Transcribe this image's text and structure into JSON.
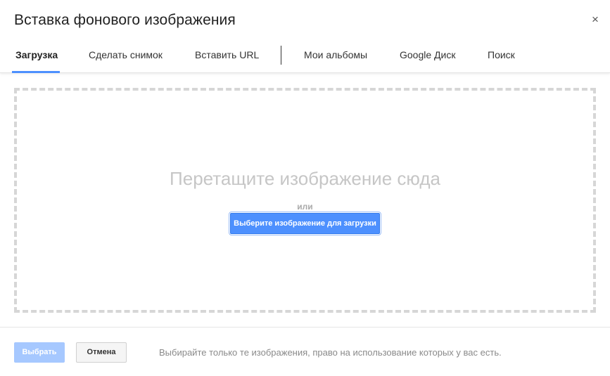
{
  "dialog": {
    "title": "Вставка фонового изображения",
    "close_icon": "close-icon",
    "close_glyph": "×"
  },
  "tabs": [
    {
      "label": "Загрузка",
      "active": true
    },
    {
      "label": "Сделать снимок",
      "active": false
    },
    {
      "label": "Вставить URL",
      "active": false
    },
    {
      "label": "Мои альбомы",
      "active": false
    },
    {
      "label": "Google Диск",
      "active": false
    },
    {
      "label": "Поиск",
      "active": false
    }
  ],
  "dropzone": {
    "title": "Перетащите изображение сюда",
    "or_text": "или",
    "select_button": "Выберите изображение для загрузки"
  },
  "footer": {
    "choose_button": "Выбрать",
    "cancel_button": "Отмена",
    "note": "Выбирайте только те изображения, право на использование которых у вас есть."
  },
  "colors": {
    "accent": "#4d90fe",
    "accent_disabled": "#a6c8ff",
    "dash_border": "#d6d6d6"
  }
}
